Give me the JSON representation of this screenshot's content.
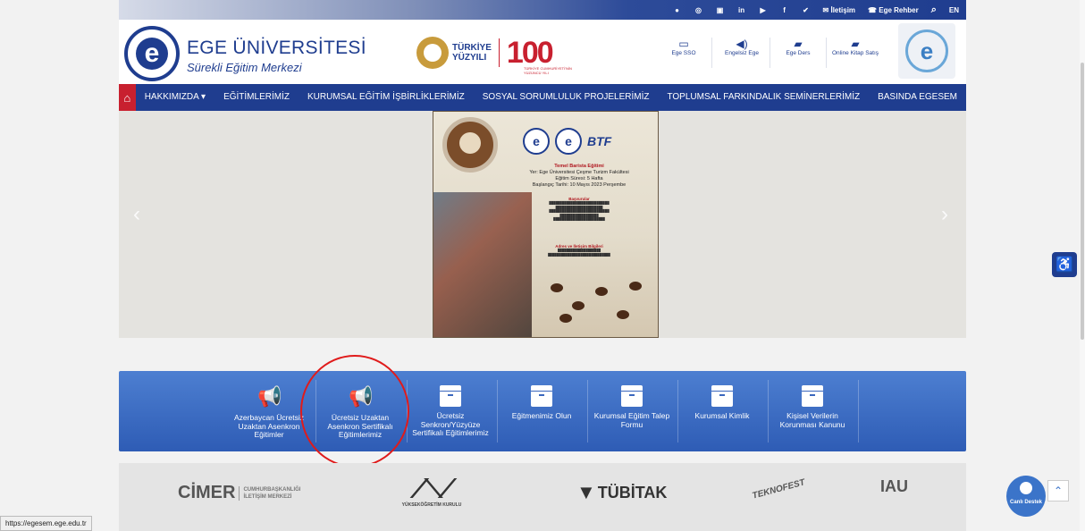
{
  "topbar": {
    "social": [
      "●",
      "◎",
      "▣",
      "in",
      "▶",
      "f",
      "✔"
    ],
    "contact": "İletişim",
    "guide": "Ege Rehber",
    "search_icon": "⌕",
    "lang": "EN"
  },
  "header": {
    "title": "EGE ÜNİVERSİTESİ",
    "subtitle": "Sürekli Eğitim Merkezi",
    "logo_letter": "e",
    "tr_line1": "TÜRKİYE",
    "tr_line2": "YÜZYILI",
    "tr_100": "100",
    "tr_small": "TÜRKİYE CUMHURİYETİ'NİN YÜZÜNCÜ YILI",
    "quick_links": [
      {
        "icon": "▭",
        "label": "Ege SSO"
      },
      {
        "icon": "◀)",
        "label": "Engelsiz Ege"
      },
      {
        "icon": "▰",
        "label": "Ege Ders"
      },
      {
        "icon": "▰",
        "label": "Online Kitap Satış"
      }
    ],
    "badge_letter": "e"
  },
  "nav": {
    "home_icon": "⌂",
    "items": [
      "HAKKIMIZDA ▾",
      "EĞİTİMLERİMİZ",
      "KURUMSAL EĞİTİM İŞBİRLİKLERİMİZ",
      "SOSYAL SORUMLULUK PROJELERİMİZ",
      "TOPLUMSAL FARKINDALIK SEMİNERLERİMİZ",
      "BASINDA EGESEM"
    ]
  },
  "slider": {
    "prev": "‹",
    "next": "›",
    "poster": {
      "btf": "BTF",
      "heading": "Temel Barista Eğitimi",
      "lines": [
        "Yer: Ege Üniversitesi Çeşme Turizm Fakültesi",
        "Eğitim Süresi: 5 Hafta",
        "Başlangıç Tarihi: 10 Mayıs 2023 Perşembe"
      ],
      "section1": "Başvurular",
      "section2": "Adres ve İletişim Bilgileri"
    }
  },
  "services": [
    {
      "icon": "megaphone",
      "label": "Azerbaycan Ücretsiz Uzaktan Asenkron Eğitimler"
    },
    {
      "icon": "megaphone",
      "label": "Ücretsiz Uzaktan Asenkron Sertifikalı Eğitimlerimiz"
    },
    {
      "icon": "box",
      "label": "Ücretsiz Senkron/Yüzyüze Sertifikalı Eğitimlerimiz"
    },
    {
      "icon": "box",
      "label": "Eğitmenimiz Olun"
    },
    {
      "icon": "box",
      "label": "Kurumsal Eğitim Talep Formu"
    },
    {
      "icon": "box",
      "label": "Kurumsal Kimlik"
    },
    {
      "icon": "box",
      "label": "Kişisel Verilerin Korunması Kanunu"
    }
  ],
  "partners": {
    "cimer": "CİMER",
    "cimer_sub1": "CUMHURBAŞKANLIĞI",
    "cimer_sub2": "İLETİŞİM MERKEZİ",
    "yok": "YÜKSEKÖĞRETİM KURULU",
    "tubitak": "TÜBİTAK",
    "teknofest": "TEKNOFEST",
    "iau": "IAU"
  },
  "widgets": {
    "accessibility_icon": "♿",
    "chat_label": "Canlı Destek",
    "to_top_icon": "⌃"
  },
  "statusbar": {
    "url": "https://egesem.ege.edu.tr"
  },
  "colors": {
    "primary": "#1f3d8f",
    "accent": "#c8202f",
    "service_bar": "#3b67bd",
    "annotation": "#e01b1b"
  }
}
